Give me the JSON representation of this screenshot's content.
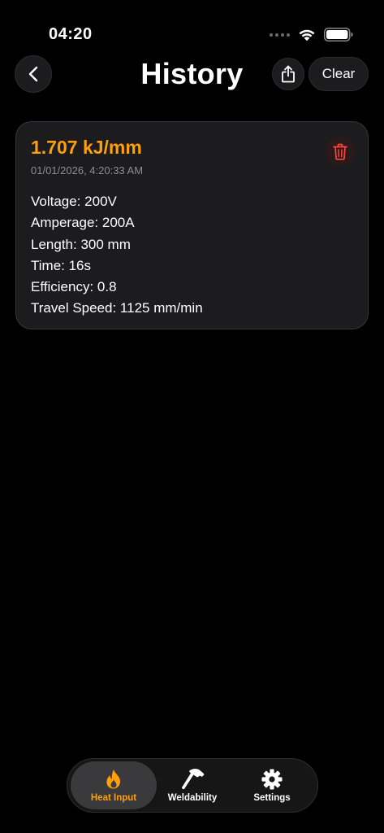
{
  "status_bar": {
    "time": "04:20",
    "icons": [
      "cellular-signal-icon",
      "wifi-icon",
      "battery-icon"
    ]
  },
  "header": {
    "title": "History",
    "back_icon": "chevron-left-icon",
    "share_icon": "share-icon",
    "clear_label": "Clear"
  },
  "history": {
    "entries": [
      {
        "heat_input": "1.707 kJ/mm",
        "timestamp": "01/01/2026, 4:20:33 AM",
        "details": [
          "Voltage: 200V",
          "Amperage: 200A",
          "Length: 300 mm",
          "Time: 16s",
          "Efficiency: 0.8",
          "Travel Speed: 1125 mm/min"
        ],
        "delete_icon": "trash-icon"
      }
    ]
  },
  "tab_bar": {
    "tabs": [
      {
        "label": "Heat Input",
        "icon": "flame-icon",
        "active": true
      },
      {
        "label": "Weldability",
        "icon": "hammer-icon",
        "active": false
      },
      {
        "label": "Settings",
        "icon": "gear-icon",
        "active": false
      }
    ]
  },
  "colors": {
    "background": "#000000",
    "card": "#1c1c1e",
    "accent": "#ff9f0a",
    "delete": "#ff453a",
    "secondary_text": "#8e8e93"
  }
}
